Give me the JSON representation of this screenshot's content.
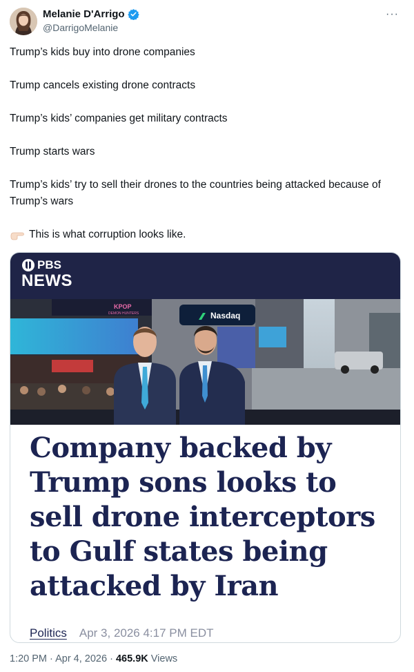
{
  "author": {
    "name": "Melanie D'Arrigo",
    "handle": "@DarrigoMelanie",
    "verified": true,
    "avatar_icon": "profile-photo",
    "more_label": "···"
  },
  "tweet": {
    "lines": [
      "Trump’s kids buy into drone companies",
      "Trump cancels existing drone contracts",
      "Trump’s kids’ companies get military contracts",
      "Trump starts wars",
      "Trump’s kids’ try to sell their drones to the countries being attacked because of Trump’s wars"
    ],
    "closing": "This is what corruption looks like.",
    "closing_icon": "pointing-hand-icon"
  },
  "card": {
    "brand_top": "PBS",
    "brand_bottom": "NEWS",
    "photo_signs": {
      "nasdaq": "Nasdaq",
      "kpop": "KPOP",
      "demon": "DEMON HUNTERS"
    },
    "headline": "Company backed by Trump sons looks to sell drone interceptors to Gulf states being attacked by Iran",
    "section": "Politics",
    "date": "Apr 3, 2026 4:17 PM EDT"
  },
  "footer": {
    "time": "1:20 PM",
    "date": "Apr 4, 2026",
    "views_count": "465.9K",
    "views_label": "Views"
  },
  "colors": {
    "pbs_bar": "#1f2447",
    "headline": "#1c2452",
    "verified_blue": "#1d9bf0",
    "secondary_text": "#536471"
  }
}
